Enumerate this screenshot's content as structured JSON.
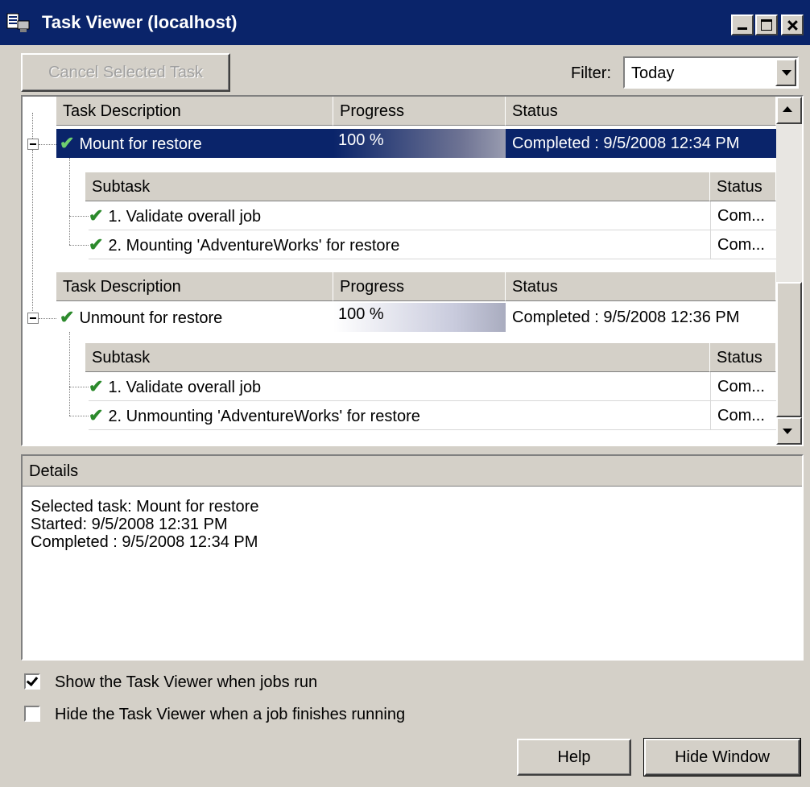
{
  "window": {
    "title": "Task Viewer (localhost)"
  },
  "toolbar": {
    "cancel_label": "Cancel Selected Task",
    "filter_label": "Filter:",
    "filter_value": "Today"
  },
  "task_columns": {
    "description": "Task Description",
    "progress": "Progress",
    "status": "Status"
  },
  "subtask_columns": {
    "subtask": "Subtask",
    "status": "Status"
  },
  "tasks": [
    {
      "description": "Mount for restore",
      "progress": "100 %",
      "progress_fraction": 1.0,
      "status": "Completed : 9/5/2008 12:34 PM",
      "selected": true,
      "subtasks": [
        {
          "label": "1. Validate overall job",
          "status": "Com..."
        },
        {
          "label": "2. Mounting 'AdventureWorks' for restore",
          "status": "Com..."
        }
      ]
    },
    {
      "description": "Unmount for restore",
      "progress": "100 %",
      "progress_fraction": 1.0,
      "status": "Completed : 9/5/2008 12:36 PM",
      "selected": false,
      "subtasks": [
        {
          "label": "1. Validate overall job",
          "status": "Com..."
        },
        {
          "label": "2. Unmounting 'AdventureWorks' for restore",
          "status": "Com..."
        }
      ]
    }
  ],
  "details": {
    "header": "Details",
    "lines": [
      "Selected task: Mount for restore",
      "Started: 9/5/2008 12:31 PM",
      "Completed : 9/5/2008 12:34 PM"
    ]
  },
  "options": {
    "show_on_run_label": "Show the Task Viewer when jobs run",
    "show_on_run_checked": true,
    "hide_on_finish_label": "Hide the Task Viewer when a job finishes running",
    "hide_on_finish_checked": false
  },
  "buttons": {
    "help": "Help",
    "hide_window": "Hide Window"
  },
  "icons": {
    "app": "task-viewer-app-icon",
    "check": "green-check-icon",
    "check_glyph": "✔"
  },
  "colors": {
    "titlebar": "#0a246a",
    "selection": "#0a246a",
    "check": "#2c8a2c",
    "face": "#d4d0c8"
  }
}
